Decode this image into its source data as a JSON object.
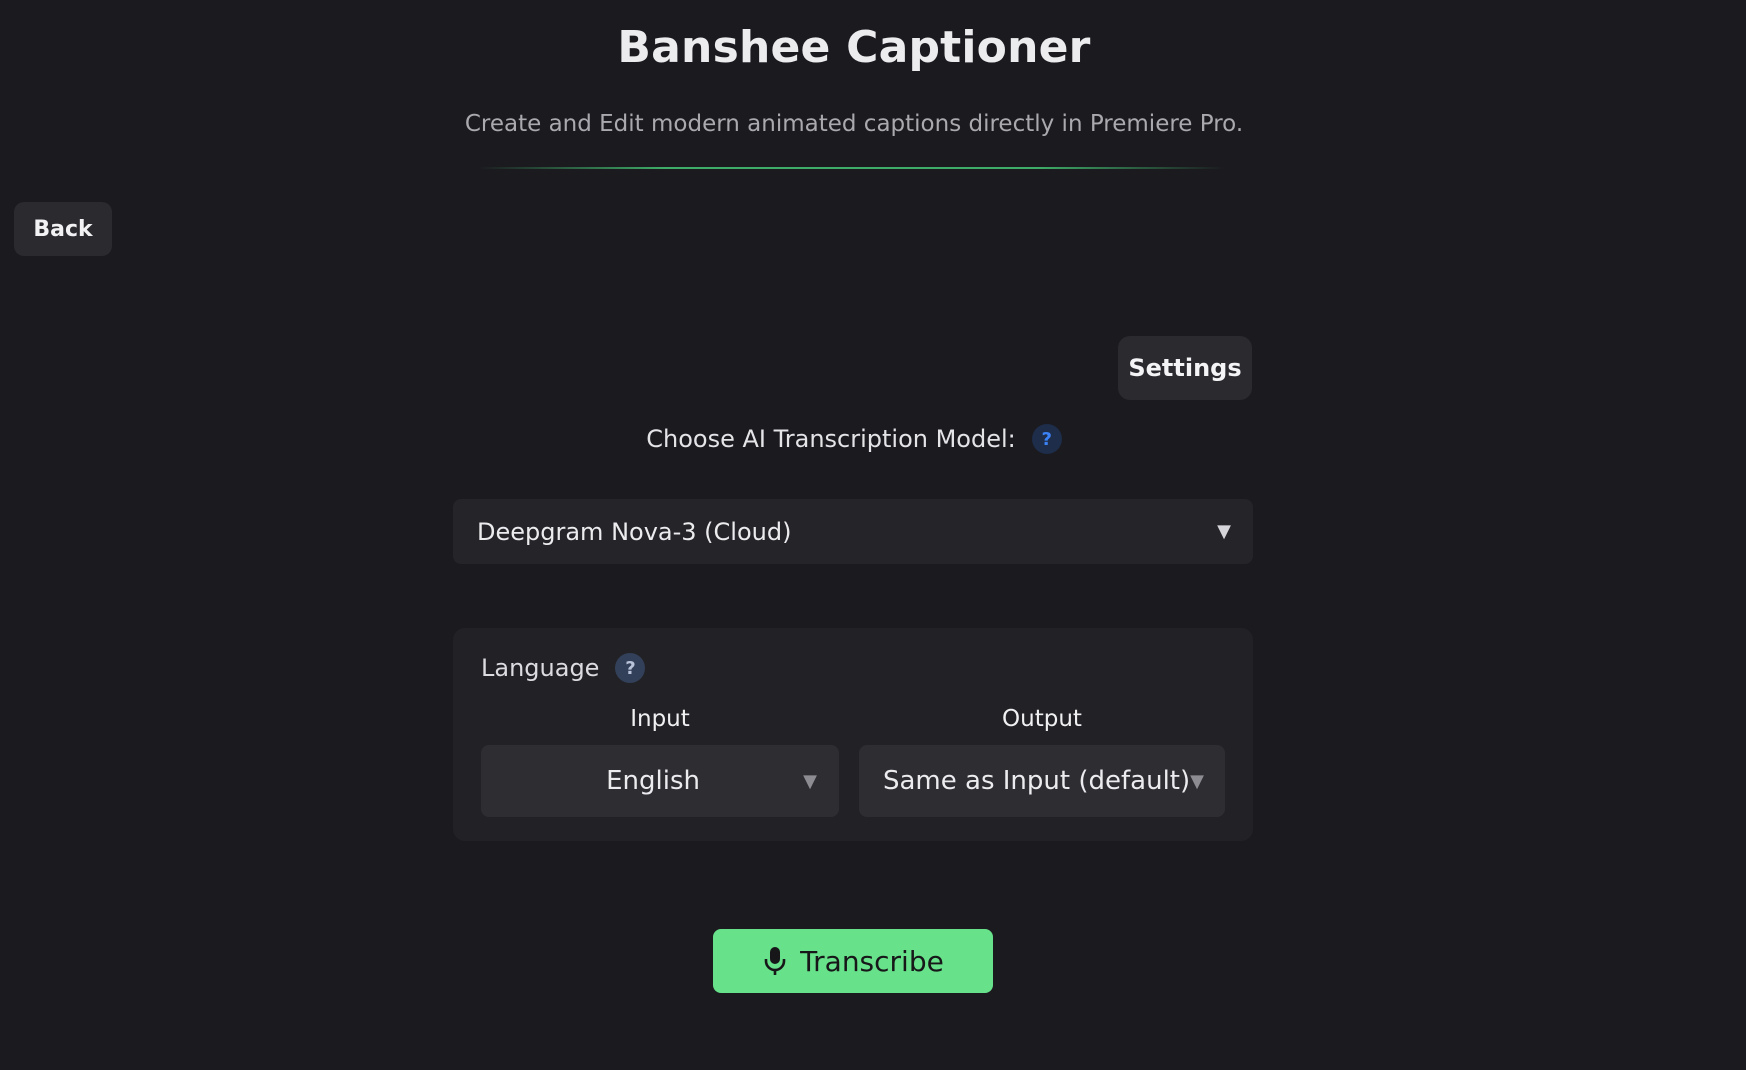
{
  "header": {
    "title": "Banshee Captioner",
    "subtitle": "Create and Edit modern animated captions directly in Premiere Pro."
  },
  "nav": {
    "back_label": "Back",
    "settings_label": "Settings"
  },
  "model": {
    "label": "Choose AI Transcription Model:",
    "help": "?",
    "selected": "Deepgram Nova-3 (Cloud)",
    "caret": "▼"
  },
  "language": {
    "title": "Language",
    "help": "?",
    "input_label": "Input",
    "output_label": "Output",
    "input_selected": "English",
    "output_selected": "Same as Input (default)",
    "caret": "▼"
  },
  "actions": {
    "transcribe_label": "Transcribe"
  },
  "colors": {
    "background": "#1b1a1f",
    "accent": "#67e18a",
    "help_blue": "#3b82f6"
  },
  "icons": {
    "transcribe": "microphone-icon",
    "help": "question-icon",
    "dropdown": "chevron-down-icon"
  }
}
